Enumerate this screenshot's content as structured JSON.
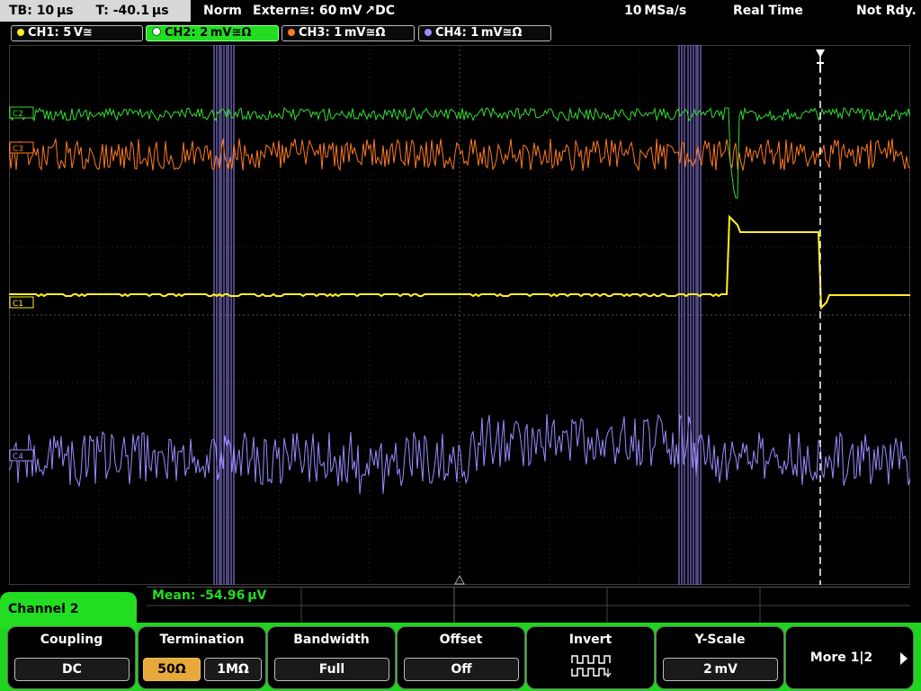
{
  "status": {
    "timebase": "TB: 10 µs",
    "trigger_time": "T: -40.1 µs",
    "mode": "Norm",
    "trigger_source": "Extern≅: 60 mV ↗DC",
    "sample_rate": "10 MSa/s",
    "acq_mode": "Real Time",
    "state": "Not Rdy."
  },
  "channels": [
    {
      "label": "CH1: 5 V≅",
      "color": "#ffee22",
      "marker": "C1"
    },
    {
      "label": "CH2: 2 mV≅Ω",
      "color": "#33dd33",
      "marker": "C2"
    },
    {
      "label": "CH3: 1 mV≅Ω",
      "color": "#ff7a22",
      "marker": "C3"
    },
    {
      "label": "CH4: 1 mV≅Ω",
      "color": "#9a8cff",
      "marker": "C4"
    }
  ],
  "measurement": {
    "mean": "Mean: -54.96 µV"
  },
  "menu": {
    "title": "Channel 2",
    "coupling": {
      "label": "Coupling",
      "value": "DC"
    },
    "termination": {
      "label": "Termination",
      "opt1": "50Ω",
      "opt2": "1MΩ"
    },
    "bandwidth": {
      "label": "Bandwidth",
      "value": "Full"
    },
    "offset": {
      "label": "Offset",
      "value": "Off"
    },
    "invert": {
      "label": "Invert"
    },
    "yscale": {
      "label": "Y-Scale",
      "value": "2 mV"
    },
    "more": {
      "label": "More 1|2"
    }
  }
}
